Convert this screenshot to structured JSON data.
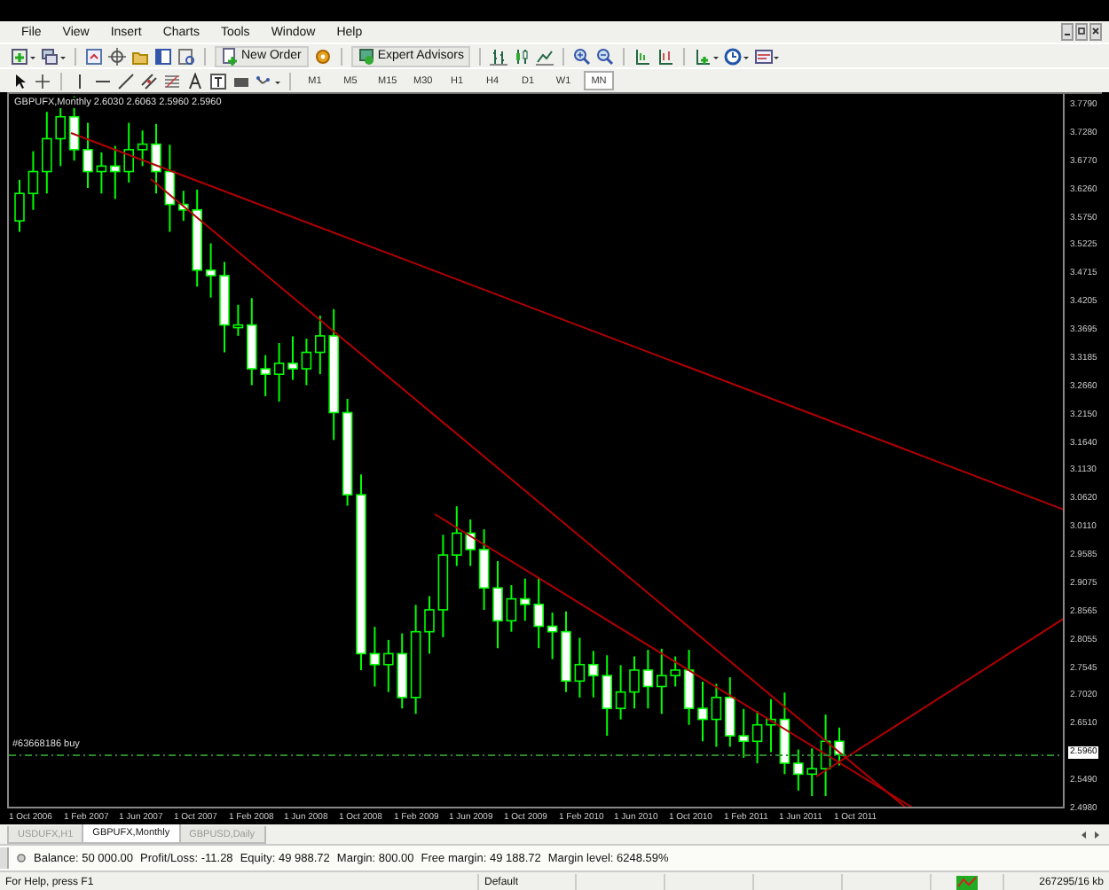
{
  "menu": [
    "File",
    "View",
    "Insert",
    "Charts",
    "Tools",
    "Window",
    "Help"
  ],
  "toolbar": {
    "new_order": "New Order",
    "expert_advisors": "Expert Advisors"
  },
  "timeframes": [
    {
      "label": "M1",
      "selected": false
    },
    {
      "label": "M5",
      "selected": false
    },
    {
      "label": "M15",
      "selected": false
    },
    {
      "label": "M30",
      "selected": false
    },
    {
      "label": "H1",
      "selected": false
    },
    {
      "label": "H4",
      "selected": false
    },
    {
      "label": "D1",
      "selected": false
    },
    {
      "label": "W1",
      "selected": false
    },
    {
      "label": "MN",
      "selected": true
    }
  ],
  "chart": {
    "title": "GBPUFX,Monthly  2.6030 2.6063 2.5960 2.5960",
    "order_label": "#63668186 buy",
    "price_labels": [
      {
        "text": "3.7790",
        "current": false
      },
      {
        "text": "3.7280",
        "current": false
      },
      {
        "text": "3.6770",
        "current": false
      },
      {
        "text": "3.6260",
        "current": false
      },
      {
        "text": "3.5750",
        "current": false
      },
      {
        "text": "3.5225",
        "current": false
      },
      {
        "text": "3.4715",
        "current": false
      },
      {
        "text": "3.4205",
        "current": false
      },
      {
        "text": "3.3695",
        "current": false
      },
      {
        "text": "3.3185",
        "current": false
      },
      {
        "text": "3.2660",
        "current": false
      },
      {
        "text": "3.2150",
        "current": false
      },
      {
        "text": "3.1640",
        "current": false
      },
      {
        "text": "3.1130",
        "current": false
      },
      {
        "text": "3.0620",
        "current": false
      },
      {
        "text": "3.0110",
        "current": false
      },
      {
        "text": "2.9585",
        "current": false
      },
      {
        "text": "2.9075",
        "current": false
      },
      {
        "text": "2.8565",
        "current": false
      },
      {
        "text": "2.8055",
        "current": false
      },
      {
        "text": "2.7545",
        "current": false
      },
      {
        "text": "2.7020",
        "current": false
      },
      {
        "text": "2.6510",
        "current": false
      },
      {
        "text": "2.5960",
        "current": true
      },
      {
        "text": "2.5490",
        "current": false
      },
      {
        "text": "2.4980",
        "current": false
      }
    ],
    "time_labels": [
      "1 Oct 2006",
      "1 Feb 2007",
      "1 Jun 2007",
      "1 Oct 2007",
      "1 Feb 2008",
      "1 Jun 2008",
      "1 Oct 2008",
      "1 Feb 2009",
      "1 Jun 2009",
      "1 Oct 2009",
      "1 Feb 2010",
      "1 Jun 2010",
      "1 Oct 2010",
      "1 Feb 2011",
      "1 Jun 2011",
      "1 Oct 2011"
    ]
  },
  "chart_tabs": [
    {
      "label": "USDUFX,H1",
      "selected": false
    },
    {
      "label": "GBPUFX,Monthly",
      "selected": true
    },
    {
      "label": "GBPUSD,Daily",
      "selected": false
    }
  ],
  "terminal": {
    "items": [
      "Balance: 50 000.00",
      "Profit/Loss: -11.28",
      "Equity: 49 988.72",
      "Margin: 800.00",
      "Free margin: 49 188.72",
      "Margin level: 6248.59%"
    ]
  },
  "status_bar": {
    "help": "For Help, press F1",
    "profile": "Default",
    "traffic": "267295/16 kb"
  }
}
